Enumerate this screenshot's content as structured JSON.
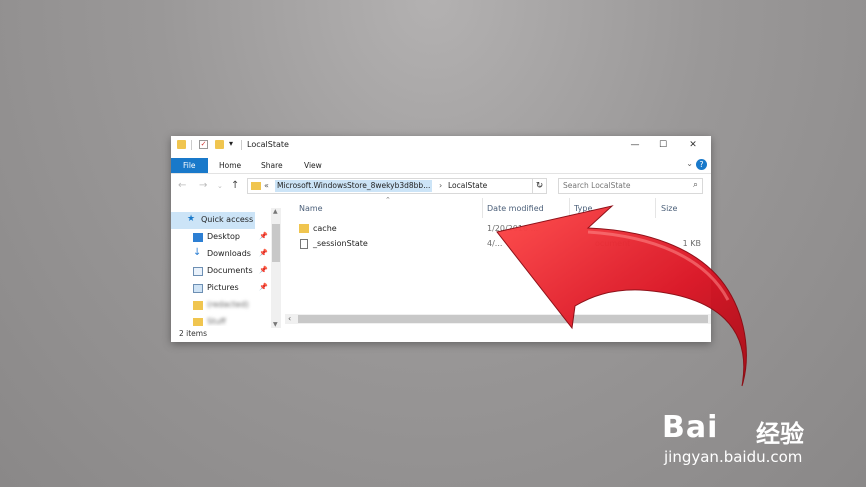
{
  "window": {
    "title": "LocalState",
    "controls": [
      "minimize-icon",
      "maximize-icon",
      "close-icon"
    ]
  },
  "ribbon": {
    "tabs": [
      "File",
      "Home",
      "Share",
      "View"
    ],
    "help": "?"
  },
  "address": {
    "overflow": "«",
    "crumb1": "Microsoft.WindowsStore_8wekyb3d8bb...",
    "separator": "›",
    "crumb2": "LocalState"
  },
  "search": {
    "placeholder": "Search LocalState"
  },
  "sidebar": {
    "items": [
      {
        "label": "Quick access",
        "icon": "star-icon"
      },
      {
        "label": "Desktop",
        "icon": "desktop-icon"
      },
      {
        "label": "Downloads",
        "icon": "download-icon"
      },
      {
        "label": "Documents",
        "icon": "documents-icon"
      },
      {
        "label": "Pictures",
        "icon": "pictures-icon"
      },
      {
        "label": "(redacted)",
        "icon": "folder-icon"
      },
      {
        "label": "Stuff",
        "icon": "folder-icon"
      }
    ]
  },
  "columns": {
    "name": "Name",
    "date": "Date modified",
    "type": "Type",
    "size": "Size"
  },
  "files": [
    {
      "name": "cache",
      "date": "1/20/2016 ...",
      "type": "",
      "size": ""
    },
    {
      "name": "_sessionState",
      "date": "4/...",
      "type": "ocument",
      "size": "1 KB"
    }
  ],
  "status": {
    "count": "2 items"
  },
  "watermark": {
    "brand": "Bai",
    "brand_cn": "经验",
    "url": "jingyan.baidu.com"
  },
  "colors": {
    "accent": "#1979ca",
    "arrow": "#e0202c",
    "folder": "#f0c54f"
  }
}
